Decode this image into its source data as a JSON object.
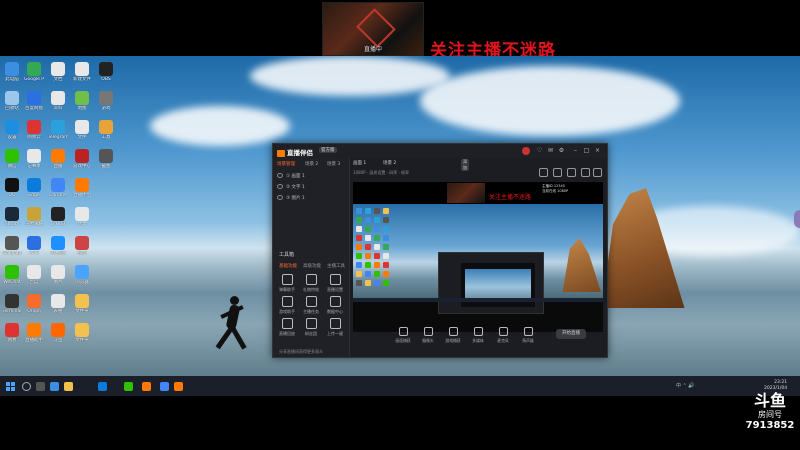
{
  "stream_overlay": {
    "banner": "关注主播不迷路",
    "thumbnail_caption": "直播中"
  },
  "desktop_icons": [
    {
      "label": "此电脑",
      "color": "#3b8ee0"
    },
    {
      "label": "Google Play",
      "color": "#34a853"
    },
    {
      "label": "文档",
      "color": "#e8e8e8"
    },
    {
      "label": "新建文件",
      "color": "#e8e8e8"
    },
    {
      "label": "OBS",
      "color": "#222"
    },
    {
      "label": "回收站",
      "color": "#9cc7ec"
    },
    {
      "label": "百度网盘",
      "color": "#2b6fe0"
    },
    {
      "label": "资料",
      "color": "#e8e8e8"
    },
    {
      "label": "地图",
      "color": "#6fbf4a"
    },
    {
      "label": "游戏",
      "color": "#777"
    },
    {
      "label": "设置",
      "color": "#1d8fe0"
    },
    {
      "label": "网易云",
      "color": "#d33"
    },
    {
      "label": "Telegram",
      "color": "#2aa1da"
    },
    {
      "label": "文件",
      "color": "#e8e8e8"
    },
    {
      "label": "工具",
      "color": "#e8a23a"
    },
    {
      "label": "微信",
      "color": "#2dc100"
    },
    {
      "label": "记事本",
      "color": "#e8e8e8"
    },
    {
      "label": "直播",
      "color": "#ff7a00"
    },
    {
      "label": "游戏中心",
      "color": "#b22"
    },
    {
      "label": "截图",
      "color": "#555"
    },
    {
      "label": "QQ",
      "color": "#111"
    },
    {
      "label": "Edge",
      "color": "#0c7bdc"
    },
    {
      "label": "Chrome",
      "color": "#4285f4"
    },
    {
      "label": "直播伴侣",
      "color": "#ff7a00"
    },
    {
      "label": "Steam",
      "color": "#1b2838"
    },
    {
      "label": "王者荣耀",
      "color": "#c9a23a"
    },
    {
      "label": "G HUB",
      "color": "#222"
    },
    {
      "label": "文本",
      "color": "#e8e8e8"
    },
    {
      "label": "Wallpaper",
      "color": "#555"
    },
    {
      "label": "WPS",
      "color": "#2b6fe0"
    },
    {
      "label": "UU加速",
      "color": "#1e90ff"
    },
    {
      "label": "狐狸",
      "color": "#c44"
    },
    {
      "label": "WeChat",
      "color": "#2dc100"
    },
    {
      "label": "百度",
      "color": "#e8e8e8"
    },
    {
      "label": "图片",
      "color": "#e8e8e8"
    },
    {
      "label": "浏览器",
      "color": "#4aa3ff"
    },
    {
      "label": "Terminal",
      "color": "#333"
    },
    {
      "label": "Origin",
      "color": "#f56c2d"
    },
    {
      "label": "表格",
      "color": "#e8e8e8"
    },
    {
      "label": "文件夹",
      "color": "#f2c14e"
    },
    {
      "label": "网易",
      "color": "#d33"
    },
    {
      "label": "直播助手",
      "color": "#ff7a00"
    },
    {
      "label": "斗鱼",
      "color": "#f60"
    },
    {
      "label": "文件夹",
      "color": "#f2c14e"
    }
  ],
  "app": {
    "title": "直播伴侣",
    "version": "官方版",
    "sidebar_tabs": [
      "场景管理",
      "场景 2",
      "场景 3"
    ],
    "scenes": [
      "① 画面 1",
      "② 文字 1",
      "③ 图片 1"
    ],
    "tools_title": "工具箱",
    "tool_tabs": [
      "基础功能",
      "高级功能",
      "主播工具"
    ],
    "tools": [
      {
        "label": "弹幕助手"
      },
      {
        "label": "礼物特效"
      },
      {
        "label": "直播设置"
      },
      {
        "label": "游戏助手"
      },
      {
        "label": "主播任务"
      },
      {
        "label": "数据中心"
      },
      {
        "label": "直播回放"
      },
      {
        "label": "粉丝团"
      },
      {
        "label": "上传一键"
      }
    ],
    "footnote": "分享直播间获得更多观众",
    "main_tabs": [
      "画面 1",
      "场景 2"
    ],
    "add_scene": "添加",
    "rate_bar": "1080P · 画质设置 · 码率 · 帧率",
    "preview": {
      "banner": "关注主播不迷路",
      "info": [
        "主播ID 12345",
        "当前在线 1080P"
      ]
    },
    "bottom_tools": [
      "画面捕获",
      "摄像头",
      "游戏捕获",
      "多媒体",
      "麦克风",
      "扬声器"
    ],
    "start_live": "开始直播"
  },
  "taskbar": {
    "tray": "中 ⌃ 🔊",
    "time": "23:21",
    "date": "2023/1/04"
  },
  "platform": {
    "brand": "斗鱼",
    "room_label": "房间号",
    "room_number": "7913852"
  }
}
